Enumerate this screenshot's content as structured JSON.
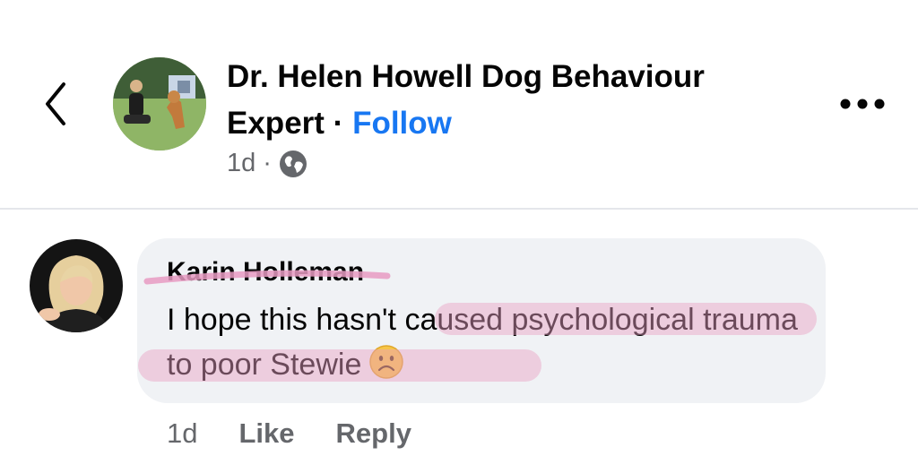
{
  "post_header": {
    "page_name": "Dr. Helen Howell Dog Behaviour Expert",
    "separator": "·",
    "follow_label": "Follow",
    "time": "1d",
    "meta_separator": "·",
    "audience_icon": "globe-icon"
  },
  "comment": {
    "author": "Karin Holleman",
    "text": "I hope this hasn't caused psychological trauma to poor Stewie",
    "emoji": "frowning-face-emoji",
    "time": "1d",
    "like_label": "Like",
    "reply_label": "Reply"
  },
  "icons": {
    "back": "chevron-left-icon",
    "more": "more-options-icon"
  },
  "colors": {
    "link": "#1877f2",
    "secondary_text": "#65676b",
    "bubble": "#f0f2f5",
    "highlight": "#e8a0c4"
  }
}
